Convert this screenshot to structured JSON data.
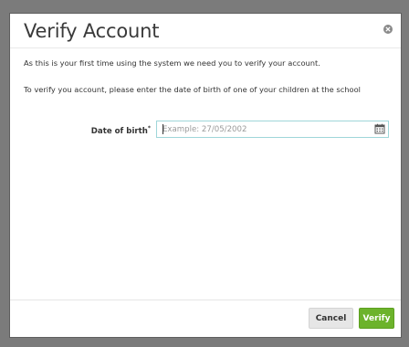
{
  "dialog": {
    "title": "Verify Account",
    "message_first_time": "As this is your first time using the system we need you to verify your account.",
    "message_instruction": "To verify you account, please enter the date of birth of one of your children at the school"
  },
  "form": {
    "dob_label": "Date of birth",
    "required_marker": "*",
    "dob_value": "",
    "dob_placeholder": "Example: 27/05/2002"
  },
  "footer": {
    "cancel_label": "Cancel",
    "verify_label": "Verify"
  },
  "icons": {
    "close": "close-icon",
    "calendar": "calendar-icon"
  },
  "colors": {
    "accent_green": "#6cb32b",
    "input_focus_border": "#9fd6d9",
    "overlay": "#7b7b7b"
  }
}
